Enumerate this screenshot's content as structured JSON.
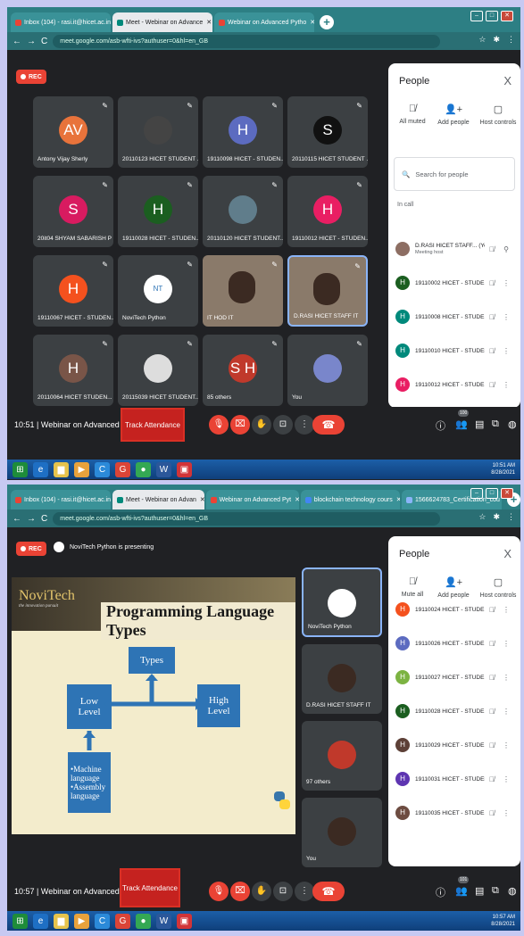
{
  "s1": {
    "tabs": [
      {
        "label": "Inbox (104) - rasi.it@hicet.ac.in",
        "color": "#ea4335",
        "active": false
      },
      {
        "label": "Meet - Webinar on Advance",
        "color": "#00897b",
        "active": true
      },
      {
        "label": "Webinar on Advanced Pytho",
        "color": "#ea4335",
        "active": false
      }
    ],
    "url": "meet.google.com/asb-wfti-ivs?authuser=0&hl=en_GB",
    "rec": "REC",
    "tiles": [
      {
        "name": "Antony Vijay Sherly",
        "initial": "AV",
        "color": "#e8733b"
      },
      {
        "name": "20110123 HICET STUDENT ...",
        "initial": "",
        "color": "#444"
      },
      {
        "name": "19110098 HICET - STUDEN...",
        "initial": "H",
        "color": "#5c6bc0"
      },
      {
        "name": "20110115 HICET STUDENT ...",
        "initial": "S",
        "color": "#111"
      },
      {
        "name": "20it04 SHYAM SABARISH P",
        "initial": "S",
        "color": "#d81b60"
      },
      {
        "name": "19110028 HICET - STUDEN...",
        "initial": "H",
        "color": "#1b5e20"
      },
      {
        "name": "20110120 HICET STUDENT...",
        "initial": "",
        "color": "#607d8b"
      },
      {
        "name": "19110012 HICET - STUDEN...",
        "initial": "H",
        "color": "#e91e63"
      },
      {
        "name": "19110067 HICET - STUDEN...",
        "initial": "H",
        "color": "#f4511e"
      },
      {
        "name": "NoviTech Python",
        "initial": "NT",
        "color": "#fff"
      },
      {
        "name": "IT HOD IT",
        "initial": "",
        "color": "#8a7a6a"
      },
      {
        "name": "D.RASI HICET STAFF IT",
        "initial": "",
        "color": "#8a7a6a"
      },
      {
        "name": "20110064 HICET STUDEN...",
        "initial": "H",
        "color": "#795548"
      },
      {
        "name": "20115039 HICET STUDENT...",
        "initial": "",
        "color": "#ddd"
      },
      {
        "name": "85 others",
        "initial": "S H",
        "color": "#c0392b"
      },
      {
        "name": "You",
        "initial": "",
        "color": "#7986cb"
      }
    ],
    "panel": {
      "title": "People",
      "close": "X",
      "actions": [
        "All muted",
        "Add people",
        "Host controls"
      ],
      "search": "Search for people",
      "incall": "In call",
      "people": [
        {
          "name": "D.RASI HICET STAFF... (You)",
          "sub": "Meeting host",
          "color": "#8d6e63",
          "initial": ""
        },
        {
          "name": "19110002 HICET - STUDE...",
          "color": "#1b5e20",
          "initial": "H"
        },
        {
          "name": "19110008 HICET - STUDE...",
          "color": "#00897b",
          "initial": "H"
        },
        {
          "name": "19110010 HICET - STUDEN...",
          "color": "#00897b",
          "initial": "H"
        },
        {
          "name": "19110012 HICET - STUDE...",
          "color": "#e91e63",
          "initial": "H"
        }
      ]
    },
    "clock": "10:51 | Webinar on Advanced Py...",
    "attendance": "Track Attendance",
    "people_count": "100",
    "tray_time": "10:51 AM",
    "tray_date": "8/28/2021"
  },
  "s2": {
    "tabs": [
      {
        "label": "Inbox (104) - rasi.it@hicet.ac.in",
        "color": "#ea4335",
        "active": false
      },
      {
        "label": "Meet - Webinar on Advan",
        "color": "#00897b",
        "active": true
      },
      {
        "label": "Webinar on Advanced Pyt",
        "color": "#ea4335",
        "active": false
      },
      {
        "label": "blockchain technology cours",
        "color": "#4285f4",
        "active": false
      },
      {
        "label": "1566624783_Certification_cou",
        "color": "#8ab4f8",
        "active": false
      }
    ],
    "url": "meet.google.com/asb-wfti-ivs?authuser=0&hl=en_GB",
    "rec": "REC",
    "presenting": "NoviTech Python is presenting",
    "slide": {
      "brand": "NoviTech",
      "tagline": "the innovation pursuit",
      "title": "Programming Language Types",
      "types": "Types",
      "low": "Low Level",
      "high": "High Level",
      "list": "•Machine language •Assembly language"
    },
    "side": [
      {
        "name": "NoviTech Python"
      },
      {
        "name": "D.RASI HICET STAFF IT"
      },
      {
        "name": "97 others"
      },
      {
        "name": "You"
      }
    ],
    "panel": {
      "title": "People",
      "close": "X",
      "actions": [
        "Mute all",
        "Add people",
        "Host controls"
      ],
      "people": [
        {
          "name": "19110024 HICET - STUDE...",
          "color": "#f4511e"
        },
        {
          "name": "19110026 HICET - STUDE...",
          "color": "#5c6bc0"
        },
        {
          "name": "19110027 HICET - STUDE...",
          "color": "#7cb342"
        },
        {
          "name": "19110028 HICET - STUDE...",
          "color": "#1b5e20"
        },
        {
          "name": "19110029 HICET - STUDE...",
          "color": "#5d4037"
        },
        {
          "name": "19110031 HICET - STUDEN...",
          "color": "#5e35b1"
        },
        {
          "name": "19110035 HICET - STUDE...",
          "color": "#6d4c41"
        }
      ]
    },
    "clock": "10:57 | Webinar on Advanced Py...",
    "attendance": "Track Attendance",
    "people_count": "101",
    "tray_time": "10:57 AM",
    "tray_date": "8/28/2021"
  }
}
